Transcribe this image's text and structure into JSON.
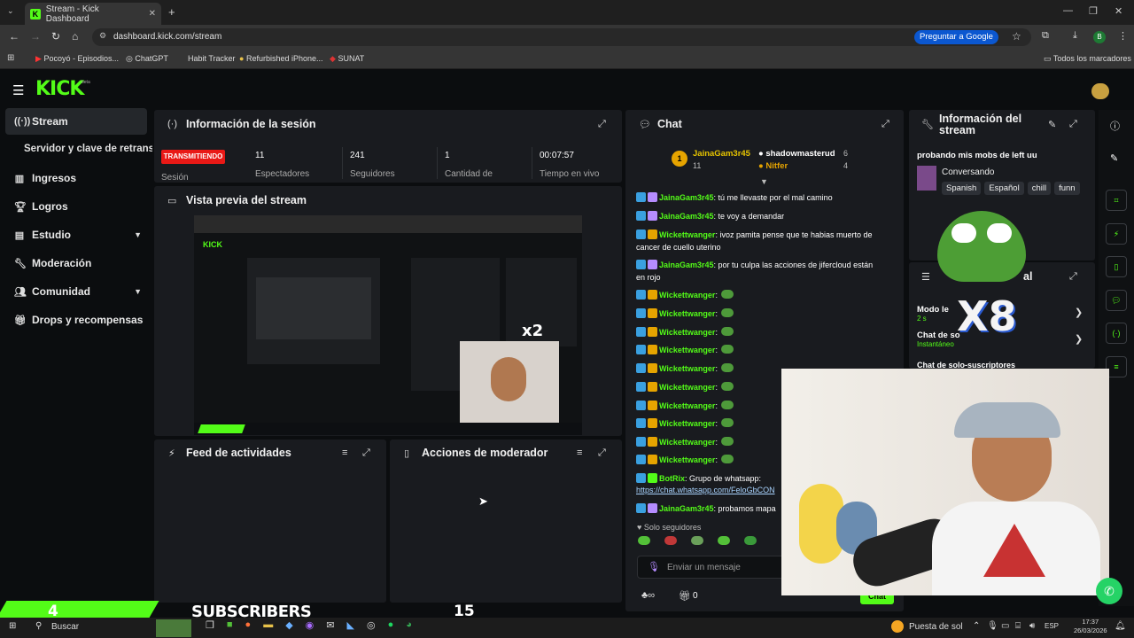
{
  "browser": {
    "tab_title": "Stream - Kick Dashboard",
    "url": "dashboard.kick.com/stream",
    "google_button": "Preguntar a Google",
    "profile_initial": "B",
    "bookmarks": [
      "Pocoyó - Episodios...",
      "ChatGPT",
      "Habit Tracker",
      "Refurbished iPhone...",
      "SUNAT"
    ],
    "all_bookmarks": "Todos los marcadores"
  },
  "brand": {
    "logo": "KICK",
    "beta": "beta",
    "accent": "#53fc18"
  },
  "sidebar": {
    "items": [
      {
        "label": "Stream",
        "icon": "broadcast-icon",
        "active": true
      },
      {
        "label": "Servidor y clave de retransmisión"
      },
      {
        "label": "Ingresos",
        "icon": "chart-icon"
      },
      {
        "label": "Logros",
        "icon": "trophy-icon"
      },
      {
        "label": "Estudio",
        "icon": "layout-icon",
        "chevron": true
      },
      {
        "label": "Moderación",
        "icon": "wrench-icon"
      },
      {
        "label": "Comunidad",
        "icon": "people-icon",
        "chevron": true
      },
      {
        "label": "Drops y recompensas",
        "icon": "gift-icon"
      }
    ]
  },
  "session": {
    "title": "Información de la sesión",
    "status": "TRANSMITIENDO",
    "status_label": "Sesión",
    "stats": [
      {
        "value": "11",
        "label": "Espectadores"
      },
      {
        "value": "241",
        "label": "Seguidores"
      },
      {
        "value": "1",
        "label": "Cantidad de"
      },
      {
        "value": "00:07:57",
        "label": "Tiempo en vivo"
      }
    ]
  },
  "preview": {
    "title": "Vista previa del stream"
  },
  "feed": {
    "title": "Feed de actividades"
  },
  "modactions": {
    "title": "Acciones de moderador"
  },
  "chat": {
    "title": "Chat",
    "leaders": [
      {
        "rank": "1",
        "name": "JainaGam3r45",
        "count": "11"
      },
      {
        "name": "shadowmasterud",
        "count": "6"
      },
      {
        "name": "Nitfer",
        "count": "4"
      }
    ],
    "messages": [
      {
        "user": "JainaGam3r45",
        "text": ": tú me llevaste por el mal camino",
        "badge": "purple"
      },
      {
        "user": "JainaGam3r45",
        "text": ": te voy a demandar",
        "badge": "purple"
      },
      {
        "user": "Wickettwanger",
        "text": ": ivoz pamita pense que te habias muerto de",
        "text2": "cancer de cuello uterino",
        "badge": "gold"
      },
      {
        "user": "JainaGam3r45",
        "text": ": por tu culpa las acciones de jifercloud están",
        "text2": "en rojo",
        "badge": "purple"
      },
      {
        "user": "Wickettwanger",
        "text": ":",
        "badge": "gold",
        "emote": true
      },
      {
        "user": "Wickettwanger",
        "text": ":",
        "badge": "gold",
        "emote": true
      },
      {
        "user": "Wickettwanger",
        "text": ":",
        "badge": "gold",
        "emote": true
      },
      {
        "user": "Wickettwanger",
        "text": ":",
        "badge": "gold",
        "emote": true
      },
      {
        "user": "Wickettwanger",
        "text": ":",
        "badge": "gold",
        "emote": true
      },
      {
        "user": "Wickettwanger",
        "text": ":",
        "badge": "gold",
        "emote": true
      },
      {
        "user": "Wickettwanger",
        "text": ":",
        "badge": "gold",
        "emote": true
      },
      {
        "user": "Wickettwanger",
        "text": ":",
        "badge": "gold",
        "emote": true
      },
      {
        "user": "Wickettwanger",
        "text": ":",
        "badge": "gold",
        "emote": true
      },
      {
        "user": "Wickettwanger",
        "text": ":",
        "badge": "gold",
        "emote": true
      }
    ],
    "bot": {
      "user": "BotRix",
      "text": ": Grupo de whatsapp:",
      "link": "https://chat.whatsapp.com/FeloGbCON"
    },
    "last": {
      "user": "JainaGam3r45",
      "text": ": probamos mapa"
    },
    "followers_only": "Solo seguidores",
    "input_placeholder": "Enviar un mensaje",
    "points": "0",
    "chat_button": "Chat"
  },
  "streaminfo": {
    "title": "Información del stream",
    "stream_title": "probando mis mobs de left uu",
    "category": "Conversando",
    "tags": [
      "Spanish",
      "Español",
      "chill",
      "funn"
    ]
  },
  "modes": {
    "title_fragment": "al",
    "mode_label": "Modo le",
    "mode_value": "2 s",
    "chat_label": "Chat de so",
    "chat_value": "Instantáneo",
    "subs_label": "Chat de solo-suscriptores"
  },
  "overlay": {
    "x8": "X8",
    "x2": "x2",
    "subs_count": "4",
    "subs_label": "SUBSCRIBERS",
    "subs_goal": "15"
  },
  "taskbar": {
    "search": "Buscar",
    "weather": "Puesta de sol",
    "lang": "ESP",
    "time": "17:37",
    "date": "26/03/2026"
  }
}
